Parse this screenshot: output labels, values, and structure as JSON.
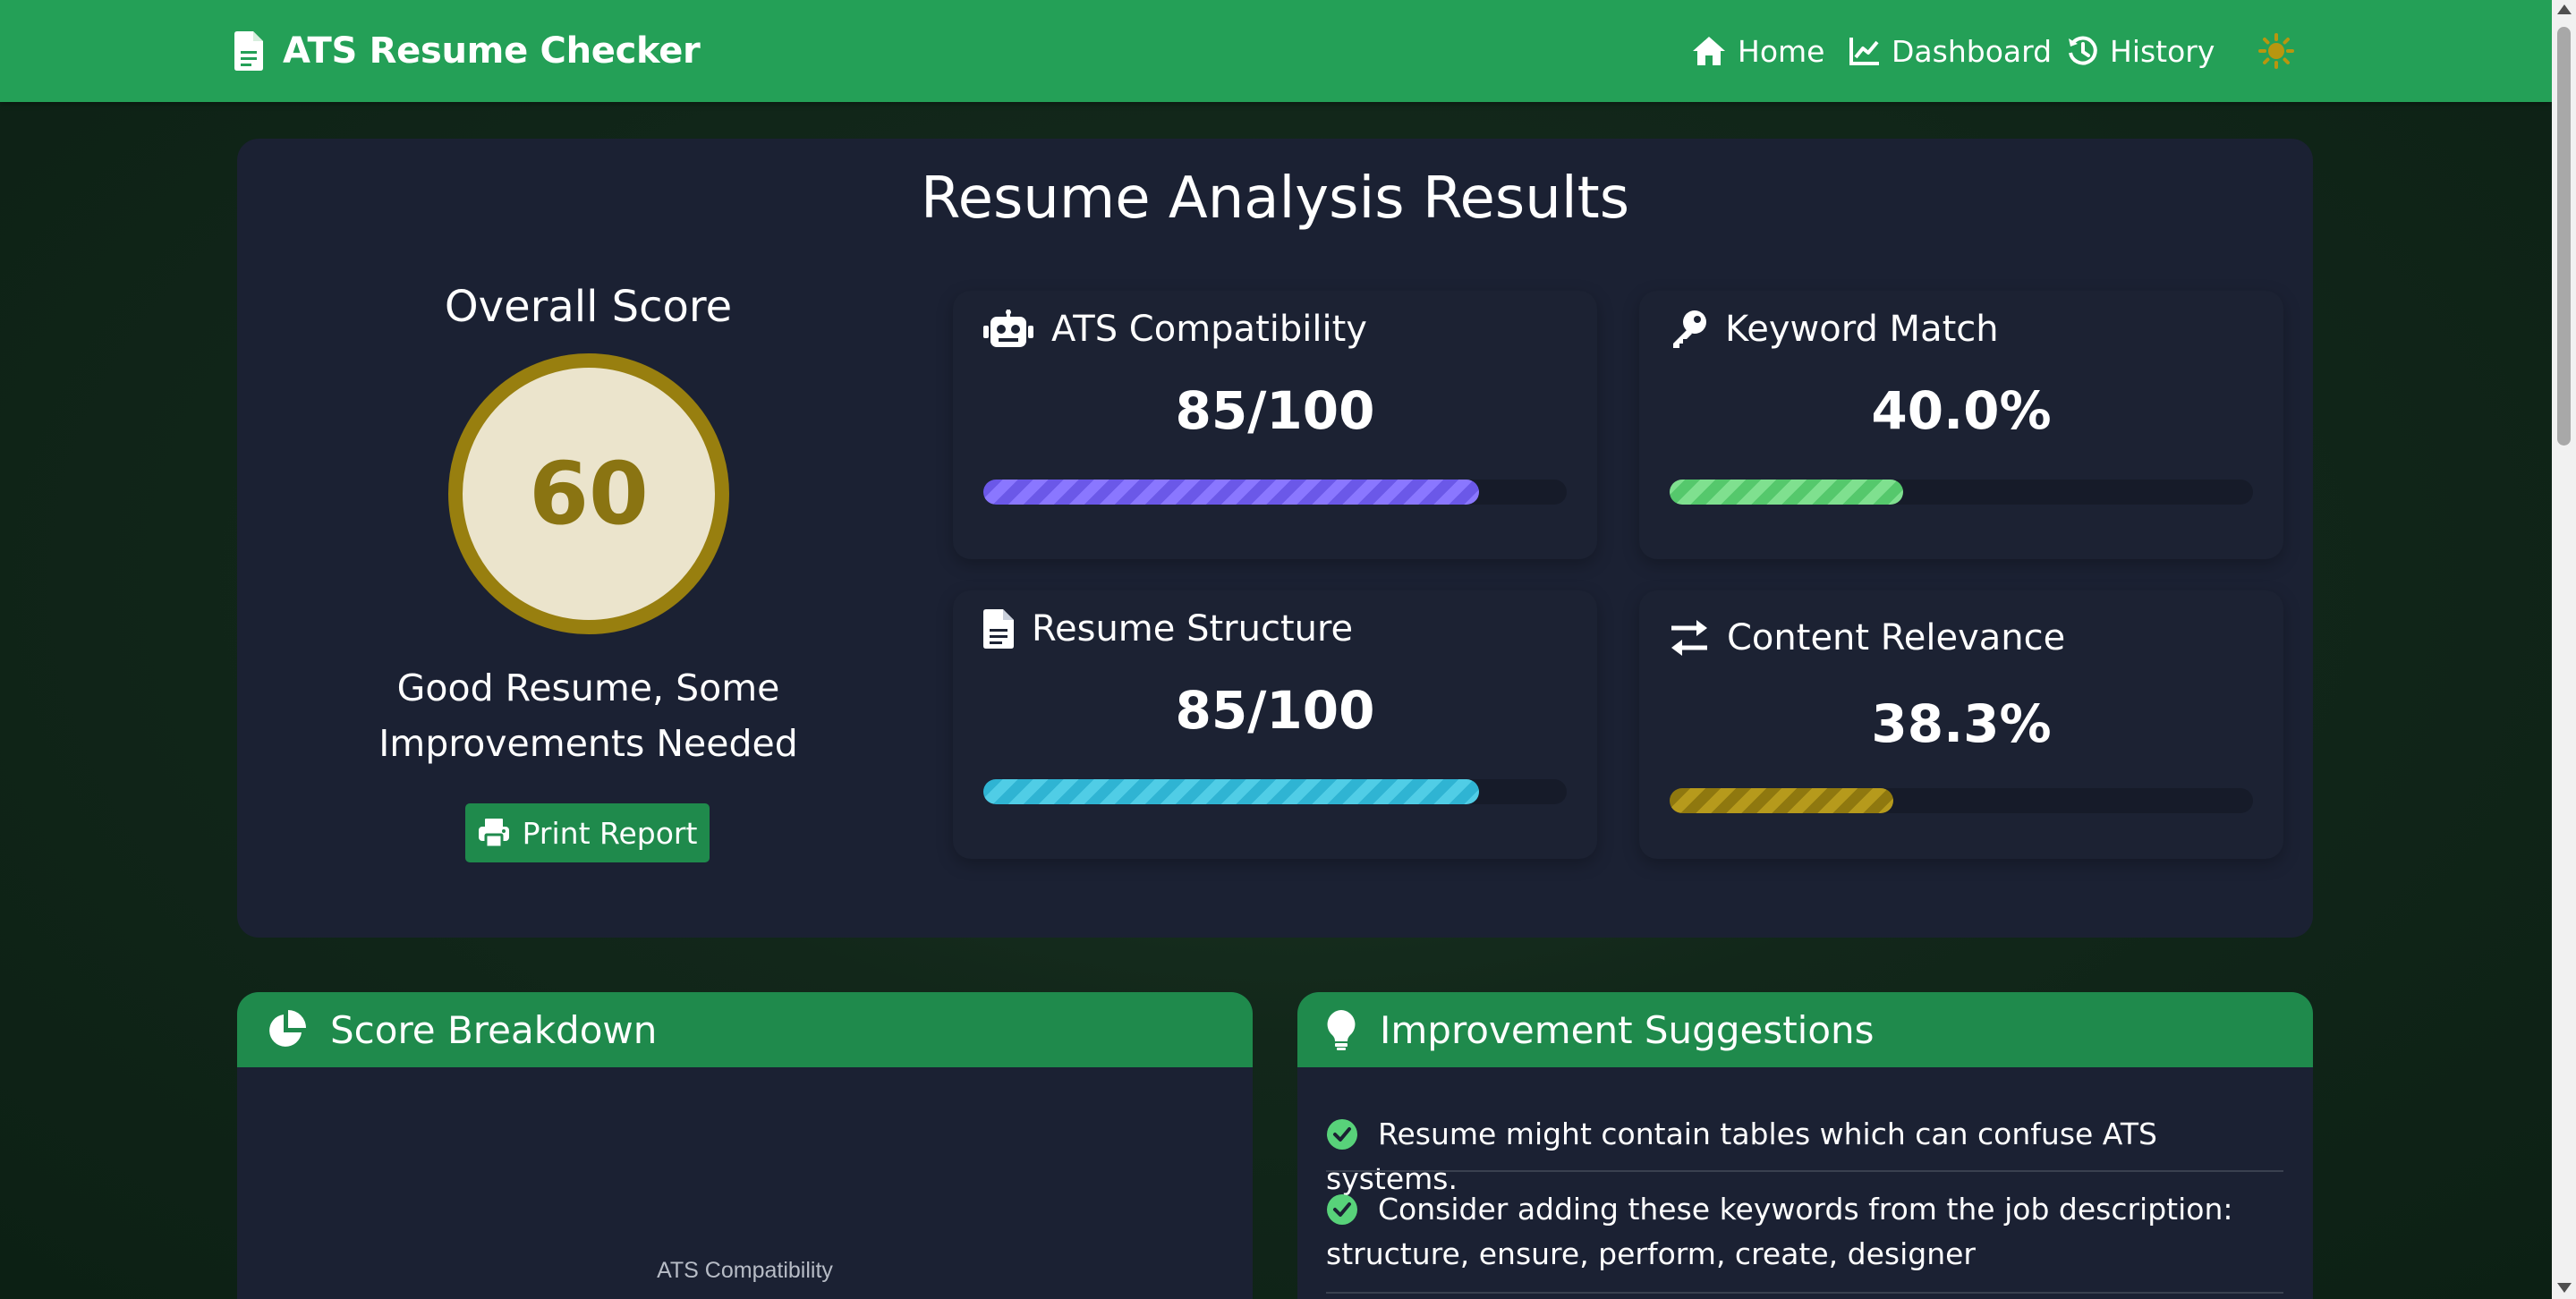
{
  "nav": {
    "brand": "ATS Resume Checker",
    "home": "Home",
    "dashboard": "Dashboard",
    "history": "History",
    "theme_icon": "sun-icon"
  },
  "results": {
    "title": "Resume Analysis Results",
    "overall_label": "Overall Score",
    "overall_score": "60",
    "verdict": "Good Resume, Some Improvements Needed",
    "print_label": "Print Report"
  },
  "metrics": {
    "ats": {
      "label": "ATS Compatibility",
      "value": "85/100",
      "fill_percent": 85,
      "icon": "robot-icon",
      "color": "#7b68ee"
    },
    "keyword": {
      "label": "Keyword Match",
      "value": "40.0%",
      "fill_percent": 40,
      "icon": "key-icon",
      "color": "#6fd47f"
    },
    "structure": {
      "label": "Resume Structure",
      "value": "85/100",
      "fill_percent": 85,
      "icon": "document-icon",
      "color": "#3ec1dd"
    },
    "relevance": {
      "label": "Content Relevance",
      "value": "38.3%",
      "fill_percent": 38.3,
      "icon": "exchange-icon",
      "color": "#a88d14"
    }
  },
  "breakdown": {
    "title": "Score Breakdown",
    "icon": "pie-chart-icon",
    "chart_label": "ATS Compatibility"
  },
  "suggestions": {
    "title": "Improvement Suggestions",
    "icon": "lightbulb-icon",
    "items": [
      "Resume might contain tables which can confuse ATS systems.",
      "Consider adding these keywords from the job description: structure, ensure, perform, create, designer"
    ]
  },
  "colors": {
    "navbar": "#24a057",
    "card": "#1b2133",
    "accent_green": "#1f8a4c",
    "score_ring": "#987f0f"
  }
}
